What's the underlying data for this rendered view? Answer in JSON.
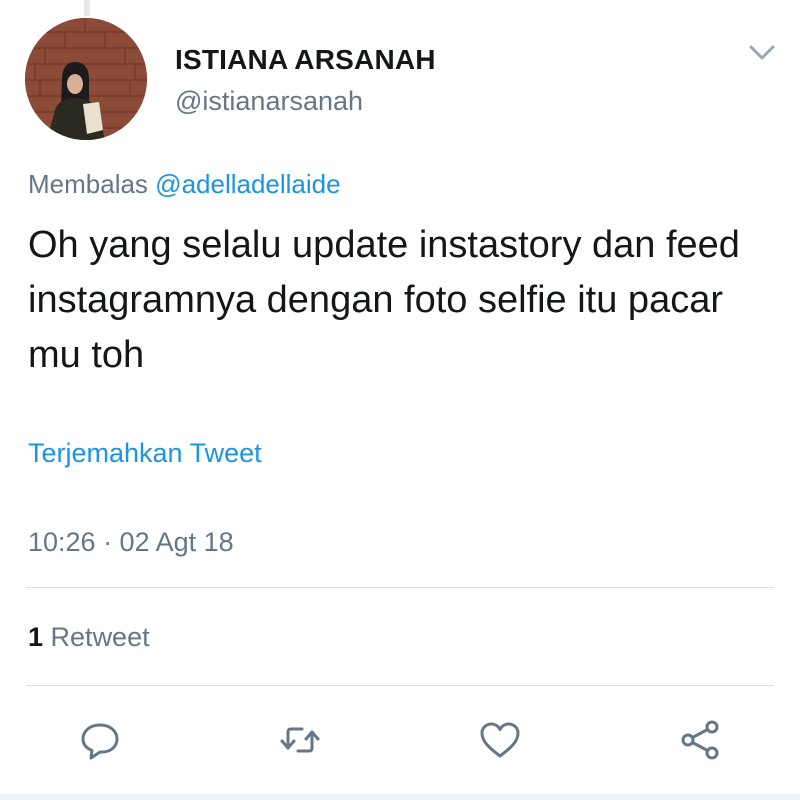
{
  "user": {
    "display_name": "ISTIANA ARSANAH",
    "handle": "@istianarsanah",
    "avatar_icon": "profile-photo-avatar"
  },
  "reply": {
    "prefix": "Membalas",
    "mention": "@adelladellaide"
  },
  "tweet": {
    "text": "Oh yang selalu update instastory dan feed instagramnya dengan foto selfie itu pacar mu toh",
    "translate_label": "Terjemahkan Tweet",
    "timestamp": "10:26 · 02 Agt 18"
  },
  "stats": {
    "retweet_count": "1",
    "retweet_label": "Retweet"
  },
  "actions": {
    "reply_icon": "reply-icon",
    "retweet_icon": "retweet-icon",
    "like_icon": "heart-icon",
    "share_icon": "share-icon"
  },
  "colors": {
    "link": "#1b95e0",
    "secondary_text": "#657786",
    "primary_text": "#14171a",
    "divider": "#d8dde2"
  }
}
